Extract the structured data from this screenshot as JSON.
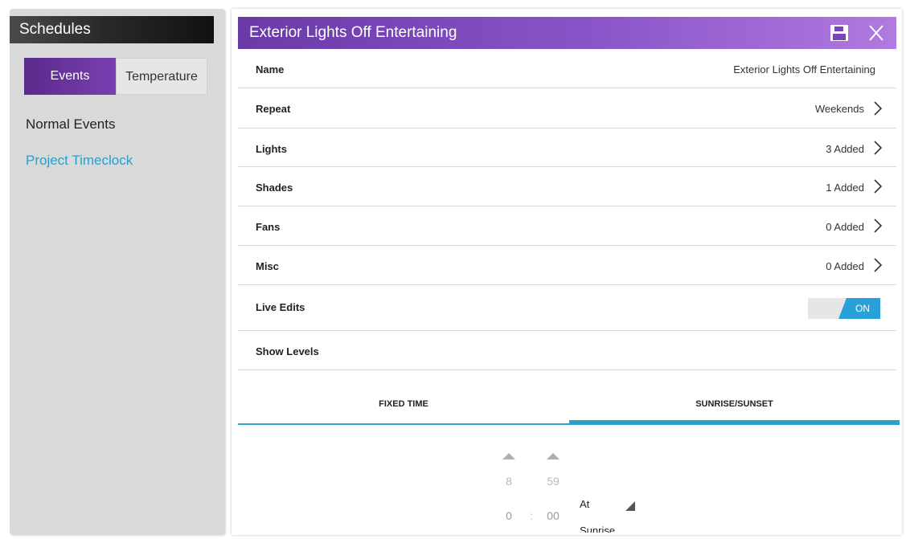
{
  "sidebar": {
    "header": "Schedules",
    "tabs": [
      {
        "label": "Events",
        "active": true
      },
      {
        "label": "Temperature",
        "active": false
      }
    ],
    "items": [
      {
        "label": "Normal Events"
      },
      {
        "label": "Project Timeclock"
      }
    ]
  },
  "editor": {
    "title": "Exterior Lights Off Entertaining",
    "rows": [
      {
        "label": "Name",
        "value": "Exterior Lights Off Entertaining"
      },
      {
        "label": "Repeat",
        "value": "Weekends"
      },
      {
        "label": "Lights",
        "value": "3 Added"
      },
      {
        "label": "Shades",
        "value": "1 Added"
      },
      {
        "label": "Fans",
        "value": "0 Added"
      },
      {
        "label": "Misc",
        "value": "0 Added"
      },
      {
        "label": "Live Edits",
        "value": "ON"
      },
      {
        "label": "Show Levels"
      }
    ],
    "time_tabs": [
      {
        "label": "FIXED TIME",
        "active": false
      },
      {
        "label": "SUNRISE/SUNSET",
        "active": true
      }
    ],
    "picker": {
      "hours_prev": "8",
      "minutes_prev": "59",
      "hours": "0",
      "separator": ":",
      "minutes": "00",
      "relation": "At",
      "event": "Sunrise"
    }
  },
  "colors": {
    "accent": "#2aa0c8",
    "title_purple": "#7a45b8",
    "events_purple": "#5a2a8c"
  },
  "icons": [
    "save-icon",
    "close-icon",
    "chevron-right-icon",
    "arrow-up-icon",
    "dropdown-triangle-icon"
  ]
}
